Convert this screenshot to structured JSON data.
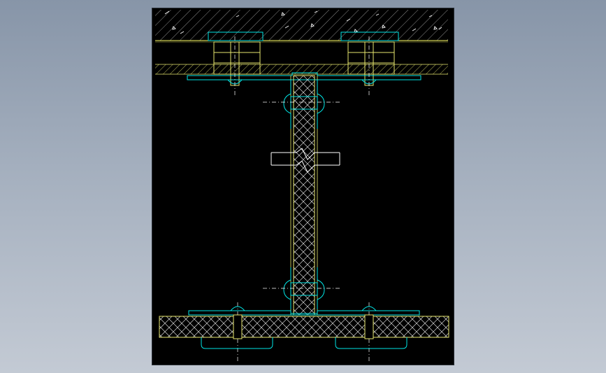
{
  "viewport": {
    "background_top": "#8795a8",
    "background_bottom": "#c3cad4"
  },
  "drawing": {
    "background": "#000000",
    "colors": {
      "concrete_hatch": "#ffffff",
      "concrete_line": "#ffff66",
      "cyan_parts": "#00e5e5",
      "yellow_lines": "#e6e66e",
      "hatch": "#e0e0e0",
      "center_line": "#ffffff"
    },
    "content": "cad-section-detail"
  }
}
